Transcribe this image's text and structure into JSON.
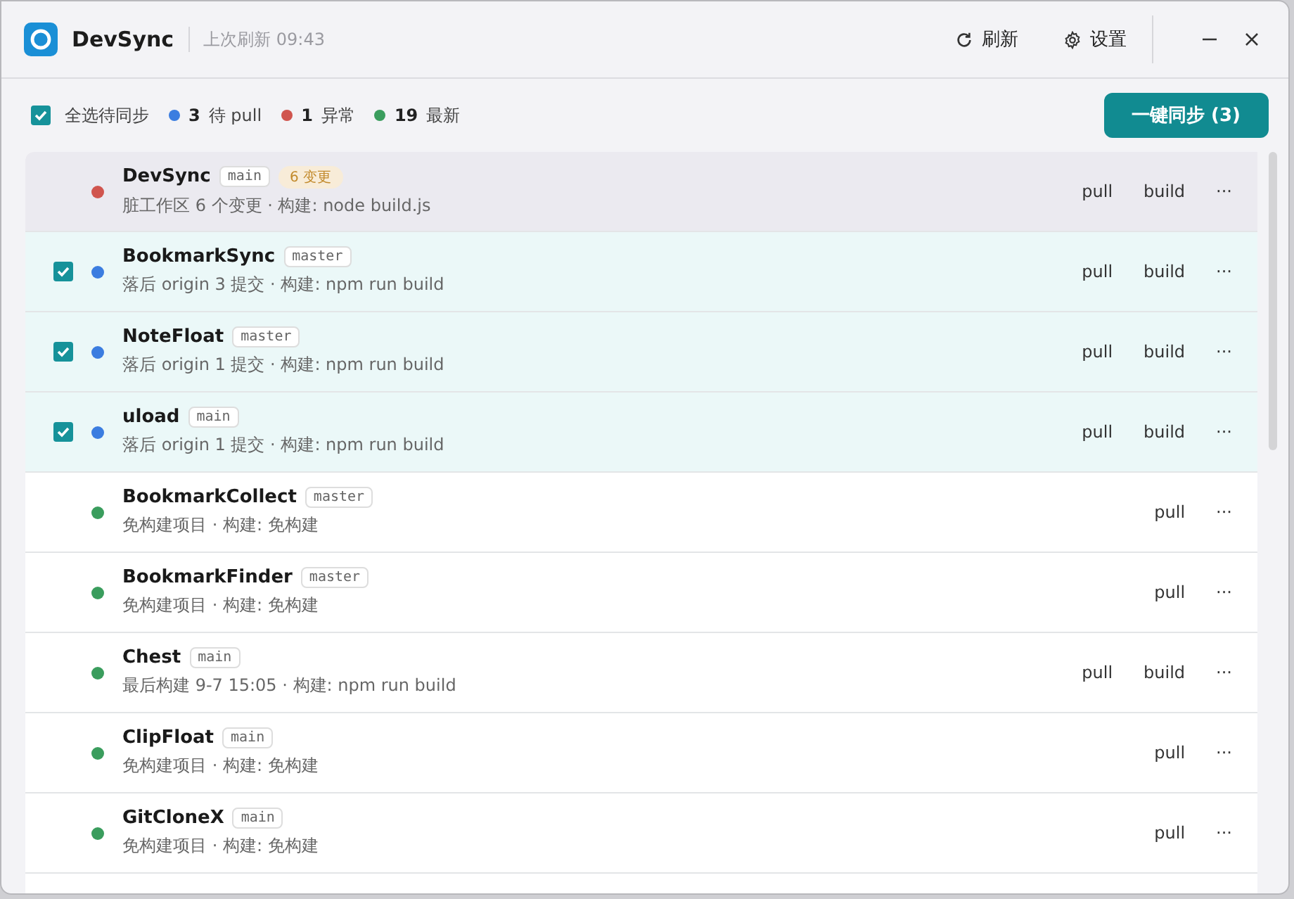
{
  "window": {
    "title": "DevSync",
    "last_refresh": "上次刷新 09:43",
    "refresh_button": "刷新",
    "settings_button": "设置"
  },
  "toolbar": {
    "select_all": {
      "label": "全选待同步",
      "checked": true
    },
    "stats": [
      {
        "count": "3",
        "label": "待 pull",
        "color": "#3b7de0"
      },
      {
        "count": "1",
        "label": "异常",
        "color": "#d0554e"
      },
      {
        "count": "19",
        "label": "最新",
        "color": "#3a9d5d"
      }
    ],
    "sync_button": "一键同步 (3)"
  },
  "repos": [
    {
      "name": "DevSync",
      "branch": "main",
      "changes": "6 变更",
      "detail": "脏工作区 6 个变更 · 构建: node build.js",
      "color": "#d0554e",
      "checked": false,
      "highlighted": true,
      "actions": [
        "pull",
        "build",
        "···"
      ]
    },
    {
      "name": "BookmarkSync",
      "branch": "master",
      "detail": "落后 origin 3 提交 · 构建: npm run build",
      "color": "#3b7de0",
      "checked": true,
      "highlighted": false,
      "actions": [
        "pull",
        "build",
        "···"
      ]
    },
    {
      "name": "NoteFloat",
      "branch": "master",
      "detail": "落后 origin 1 提交 · 构建: npm run build",
      "color": "#3b7de0",
      "checked": true,
      "highlighted": false,
      "actions": [
        "pull",
        "build",
        "···"
      ]
    },
    {
      "name": "uload",
      "branch": "main",
      "detail": "落后 origin 1 提交 · 构建: npm run build",
      "color": "#3b7de0",
      "checked": true,
      "highlighted": false,
      "actions": [
        "pull",
        "build",
        "···"
      ]
    },
    {
      "name": "BookmarkCollect",
      "branch": "master",
      "detail": "免构建项目 · 构建: 免构建",
      "color": "#3a9d5d",
      "checked": false,
      "highlighted": false,
      "actions": [
        "pull",
        "···"
      ]
    },
    {
      "name": "BookmarkFinder",
      "branch": "master",
      "detail": "免构建项目 · 构建: 免构建",
      "color": "#3a9d5d",
      "checked": false,
      "highlighted": false,
      "actions": [
        "pull",
        "···"
      ]
    },
    {
      "name": "Chest",
      "branch": "main",
      "detail": "最后构建 9-7 15:05 · 构建: npm run build",
      "color": "#3a9d5d",
      "checked": false,
      "highlighted": false,
      "actions": [
        "pull",
        "build",
        "···"
      ]
    },
    {
      "name": "ClipFloat",
      "branch": "main",
      "detail": "免构建项目 · 构建: 免构建",
      "color": "#3a9d5d",
      "checked": false,
      "highlighted": false,
      "actions": [
        "pull",
        "···"
      ]
    },
    {
      "name": "GitCloneX",
      "branch": "main",
      "detail": "免构建项目 · 构建: 免构建",
      "color": "#3a9d5d",
      "checked": false,
      "highlighted": false,
      "actions": [
        "pull",
        "···"
      ]
    }
  ]
}
